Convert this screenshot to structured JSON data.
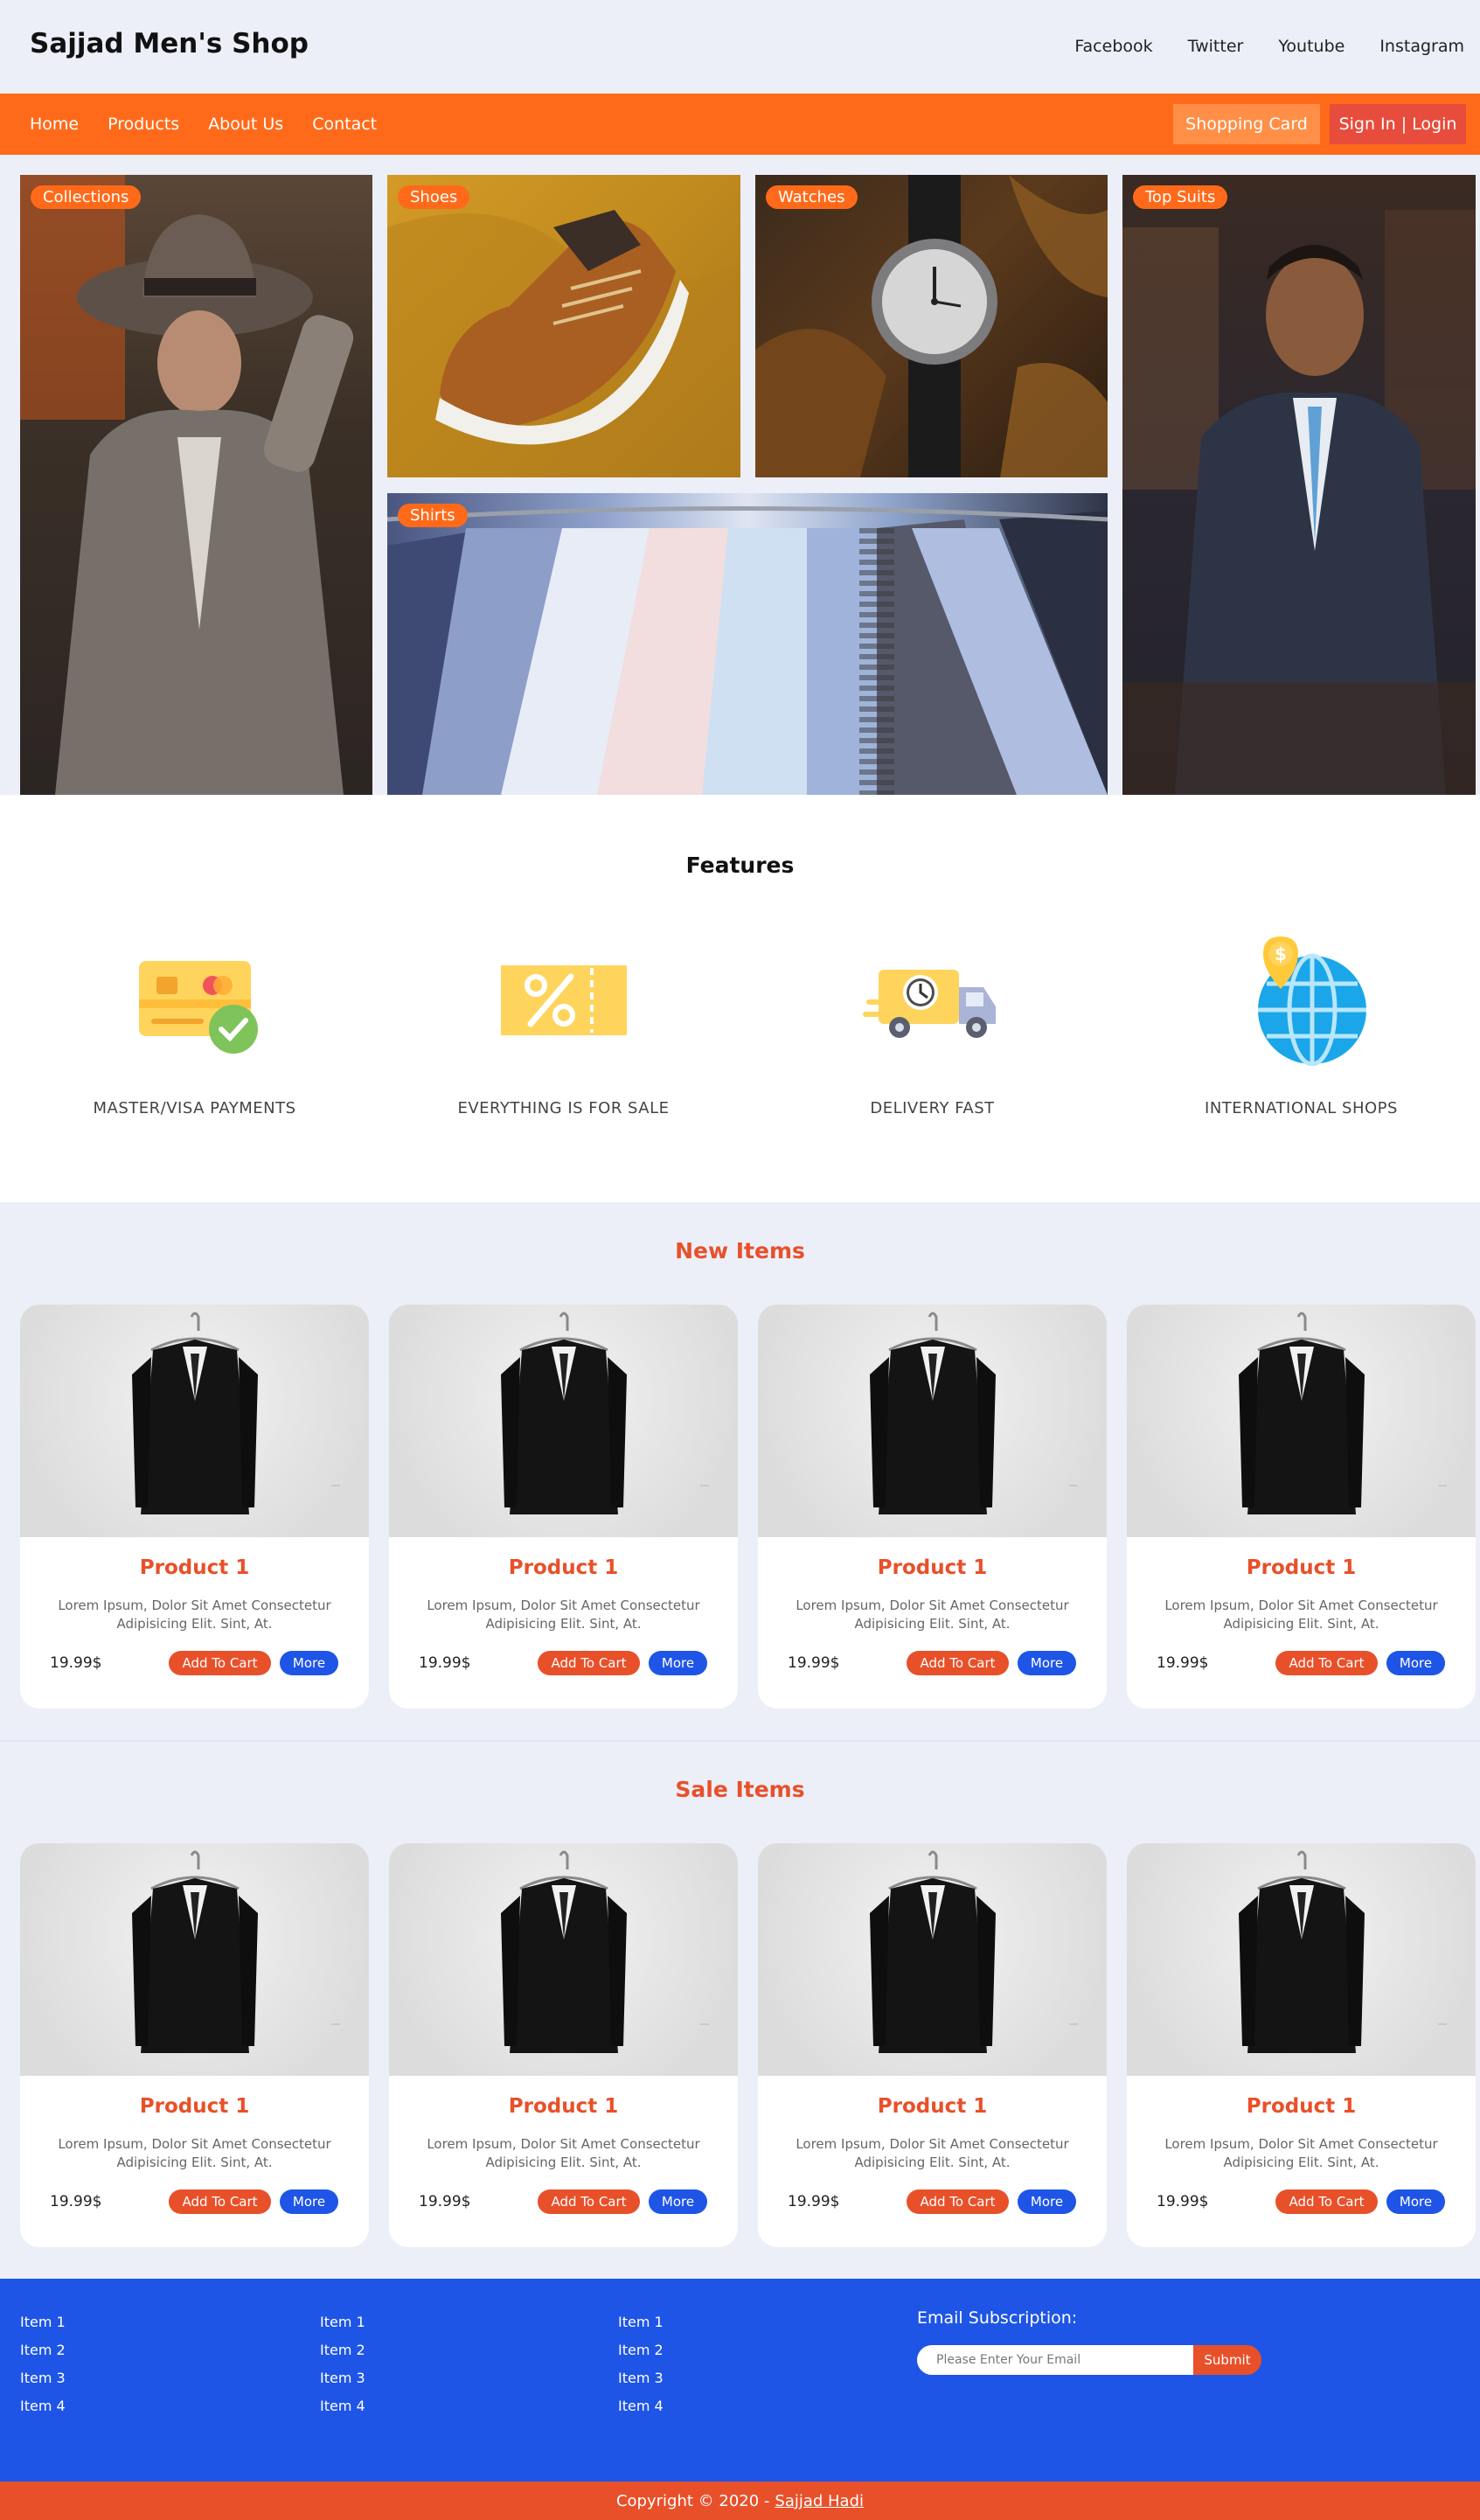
{
  "header": {
    "logo": "Sajjad Men's Shop",
    "social": [
      "Facebook",
      "Twitter",
      "Youtube",
      "Instagram"
    ]
  },
  "nav": {
    "links": [
      "Home",
      "Products",
      "About Us",
      "Contact"
    ],
    "cart_label": "Shopping Card",
    "login_label": "Sign In | Login"
  },
  "gallery": {
    "collections": "Collections",
    "shoes": "Shoes",
    "watches": "Watches",
    "shirts": "Shirts",
    "suits": "Top Suits"
  },
  "features": {
    "title": "Features",
    "items": [
      {
        "label": "MASTER/VISA PAYMENTS",
        "icon": "credit-card-check-icon"
      },
      {
        "label": "EVERYTHING IS FOR SALE",
        "icon": "discount-ticket-icon"
      },
      {
        "label": "DELIVERY FAST",
        "icon": "delivery-truck-icon"
      },
      {
        "label": "INTERNATIONAL SHOPS",
        "icon": "globe-dollar-icon"
      }
    ]
  },
  "new_items": {
    "title": "New Items",
    "products": [
      {
        "name": "Product 1",
        "desc": "Lorem Ipsum, Dolor Sit Amet Consectetur Adipisicing Elit. Sint, At.",
        "price": "19.99$",
        "add": "Add To Cart",
        "more": "More"
      },
      {
        "name": "Product 1",
        "desc": "Lorem Ipsum, Dolor Sit Amet Consectetur Adipisicing Elit. Sint, At.",
        "price": "19.99$",
        "add": "Add To Cart",
        "more": "More"
      },
      {
        "name": "Product 1",
        "desc": "Lorem Ipsum, Dolor Sit Amet Consectetur Adipisicing Elit. Sint, At.",
        "price": "19.99$",
        "add": "Add To Cart",
        "more": "More"
      },
      {
        "name": "Product 1",
        "desc": "Lorem Ipsum, Dolor Sit Amet Consectetur Adipisicing Elit. Sint, At.",
        "price": "19.99$",
        "add": "Add To Cart",
        "more": "More"
      }
    ]
  },
  "sale_items": {
    "title": "Sale Items",
    "products": [
      {
        "name": "Product 1",
        "desc": "Lorem Ipsum, Dolor Sit Amet Consectetur Adipisicing Elit. Sint, At.",
        "price": "19.99$",
        "add": "Add To Cart",
        "more": "More"
      },
      {
        "name": "Product 1",
        "desc": "Lorem Ipsum, Dolor Sit Amet Consectetur Adipisicing Elit. Sint, At.",
        "price": "19.99$",
        "add": "Add To Cart",
        "more": "More"
      },
      {
        "name": "Product 1",
        "desc": "Lorem Ipsum, Dolor Sit Amet Consectetur Adipisicing Elit. Sint, At.",
        "price": "19.99$",
        "add": "Add To Cart",
        "more": "More"
      },
      {
        "name": "Product 1",
        "desc": "Lorem Ipsum, Dolor Sit Amet Consectetur Adipisicing Elit. Sint, At.",
        "price": "19.99$",
        "add": "Add To Cart",
        "more": "More"
      }
    ]
  },
  "footer": {
    "columns": [
      [
        "Item 1",
        "Item 2",
        "Item 3",
        "Item 4"
      ],
      [
        "Item 1",
        "Item 2",
        "Item 3",
        "Item 4"
      ],
      [
        "Item 1",
        "Item 2",
        "Item 3",
        "Item 4"
      ]
    ],
    "subscription_title": "Email Subscription:",
    "email_placeholder": "Please Enter Your Email",
    "submit_label": "Submit",
    "copyright_prefix": "Copyright © 2020 -",
    "copyright_author": "Sajjad Hadi"
  },
  "colors": {
    "orange": "#ff6a1a",
    "red": "#e8502a",
    "blue": "#1e55e6",
    "background": "#eceff8"
  }
}
